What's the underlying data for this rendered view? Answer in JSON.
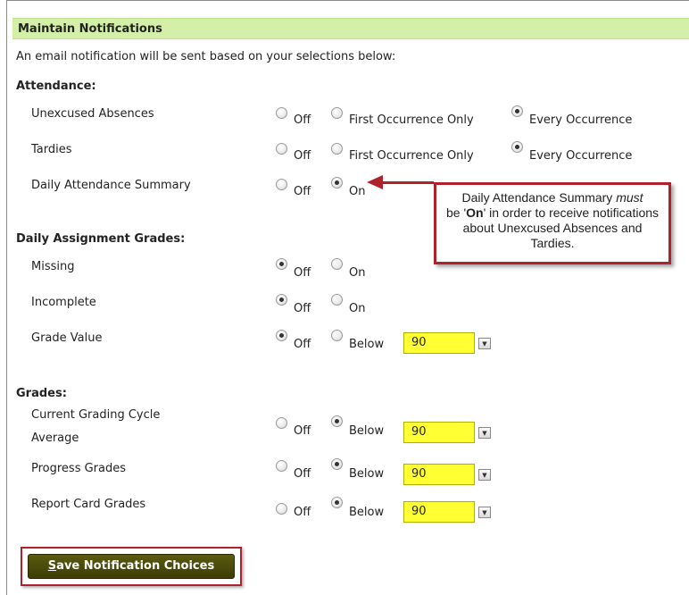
{
  "header": {
    "title": "Maintain Notifications"
  },
  "intro": "An email notification will be sent based on your selections below:",
  "sections": {
    "attendance": {
      "title": "Attendance:",
      "rows": [
        {
          "label": "Unexcused Absences",
          "options": [
            "Off",
            "First Occurrence Only",
            "Every Occurrence"
          ],
          "selected": "Every Occurrence"
        },
        {
          "label": "Tardies",
          "options": [
            "Off",
            "First Occurrence Only",
            "Every Occurrence"
          ],
          "selected": "Every Occurrence"
        },
        {
          "label": "Daily Attendance Summary",
          "options": [
            "Off",
            "On"
          ],
          "selected": "On"
        }
      ]
    },
    "assignments": {
      "title": "Daily Assignment Grades:",
      "rows": [
        {
          "label": "Missing",
          "options": [
            "Off",
            "On"
          ],
          "selected": "Off"
        },
        {
          "label": "Incomplete",
          "options": [
            "Off",
            "On"
          ],
          "selected": "Off"
        },
        {
          "label": "Grade Value",
          "options": [
            "Off",
            "Below"
          ],
          "selected": "Off",
          "threshold": "90"
        }
      ]
    },
    "grades": {
      "title": "Grades:",
      "rows": [
        {
          "label_line1": "Current Grading Cycle",
          "label_line2": "Average",
          "options": [
            "Off",
            "Below"
          ],
          "selected": "Below",
          "threshold": "90"
        },
        {
          "label": "Progress Grades",
          "options": [
            "Off",
            "Below"
          ],
          "selected": "Below",
          "threshold": "90"
        },
        {
          "label": "Report Card Grades",
          "options": [
            "Off",
            "Below"
          ],
          "selected": "Below",
          "threshold": "90"
        }
      ]
    }
  },
  "callout": {
    "part1": "Daily Attendance Summary ",
    "emph": "must",
    "part2": "be '",
    "bold": "On",
    "part3": "' in order to receive notifications about Unexcused Absences and Tardies."
  },
  "save_button": {
    "first_letter": "S",
    "rest": "ave Notification Choices"
  },
  "colors": {
    "header_bg": "#d4f0a8",
    "select_bg": "#ffff33",
    "accent": "#b0222b",
    "button_bg": "#4a4a0a"
  }
}
